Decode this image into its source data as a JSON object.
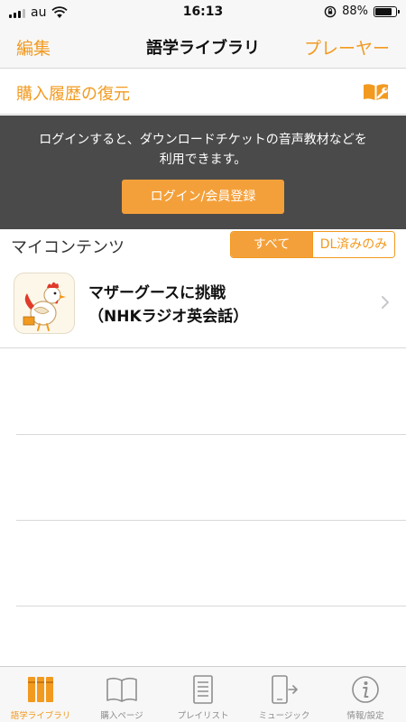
{
  "status_bar": {
    "carrier": "au",
    "time": "16:13",
    "battery_percent": "88%",
    "battery_level": 0.88,
    "icons": [
      "signal-icon",
      "wifi-icon",
      "rotation-lock-icon",
      "battery-icon"
    ]
  },
  "nav": {
    "edit_label": "編集",
    "title": "語学ライブラリ",
    "player_label": "プレーヤー"
  },
  "restore": {
    "label": "購入履歴の復元",
    "icon": "book-wrench-icon"
  },
  "login_banner": {
    "message": "ログインすると、ダウンロードチケットの音声教材などを\n利用できます。",
    "button_label": "ログイン/会員登録"
  },
  "my_contents": {
    "title": "マイコンテンツ",
    "filter_all": "すべて",
    "filter_downloaded": "DL済みのみ",
    "selected_filter": "すべて"
  },
  "items": [
    {
      "title_line1": "マザーグースに挑戦",
      "title_line2": "（NHKラジオ英会話）",
      "thumbnail": "rooster-illustration"
    }
  ],
  "tabs": [
    {
      "label": "語学ライブラリ",
      "icon": "books-icon",
      "active": true
    },
    {
      "label": "購入ページ",
      "icon": "open-book-icon",
      "active": false
    },
    {
      "label": "プレイリスト",
      "icon": "list-icon",
      "active": false
    },
    {
      "label": "ミュージック",
      "icon": "phone-export-icon",
      "active": false
    },
    {
      "label": "情報/設定",
      "icon": "info-icon",
      "active": false
    }
  ],
  "colors": {
    "accent": "#f29a1f",
    "banner_bg": "#4a4a4a",
    "button_bg": "#f4a03a",
    "bar_bg": "#f7f7f7",
    "tab_inactive": "#8e8e8e"
  }
}
